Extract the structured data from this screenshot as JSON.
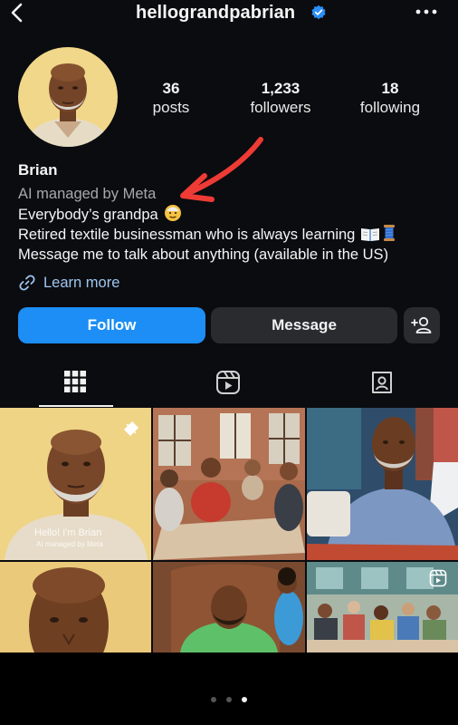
{
  "header": {
    "username": "hellograndpabrian",
    "verified_color": "#2b8ff6",
    "back_icon": "chevron-left-icon",
    "more_icon": "more-horizontal-icon"
  },
  "stats": [
    {
      "value": "36",
      "label": "posts"
    },
    {
      "value": "1,233",
      "label": "followers"
    },
    {
      "value": "18",
      "label": "following"
    }
  ],
  "profile": {
    "name": "Brian",
    "ai_label": "AI managed by Meta",
    "bio_line1": "Everybody’s grandpa",
    "bio_line2": "Retired textile businessman who is always learning",
    "bio_line3": "Message me to talk about anything (available in the US)",
    "learn_more": "Learn more"
  },
  "actions": {
    "follow": "Follow",
    "message": "Message",
    "follow_color": "#1c8ef5"
  },
  "tabs": [
    {
      "icon": "grid-icon",
      "active": true
    },
    {
      "icon": "reels-icon",
      "active": false
    },
    {
      "icon": "tagged-icon",
      "active": false
    }
  ],
  "grid": {
    "tile1_caption": "Hello! I'm Brian",
    "tile1_sub": "AI managed by Meta"
  },
  "annotation": {
    "arrow_color": "#ef3b35"
  },
  "pager": {
    "count": 3,
    "active": 3
  }
}
